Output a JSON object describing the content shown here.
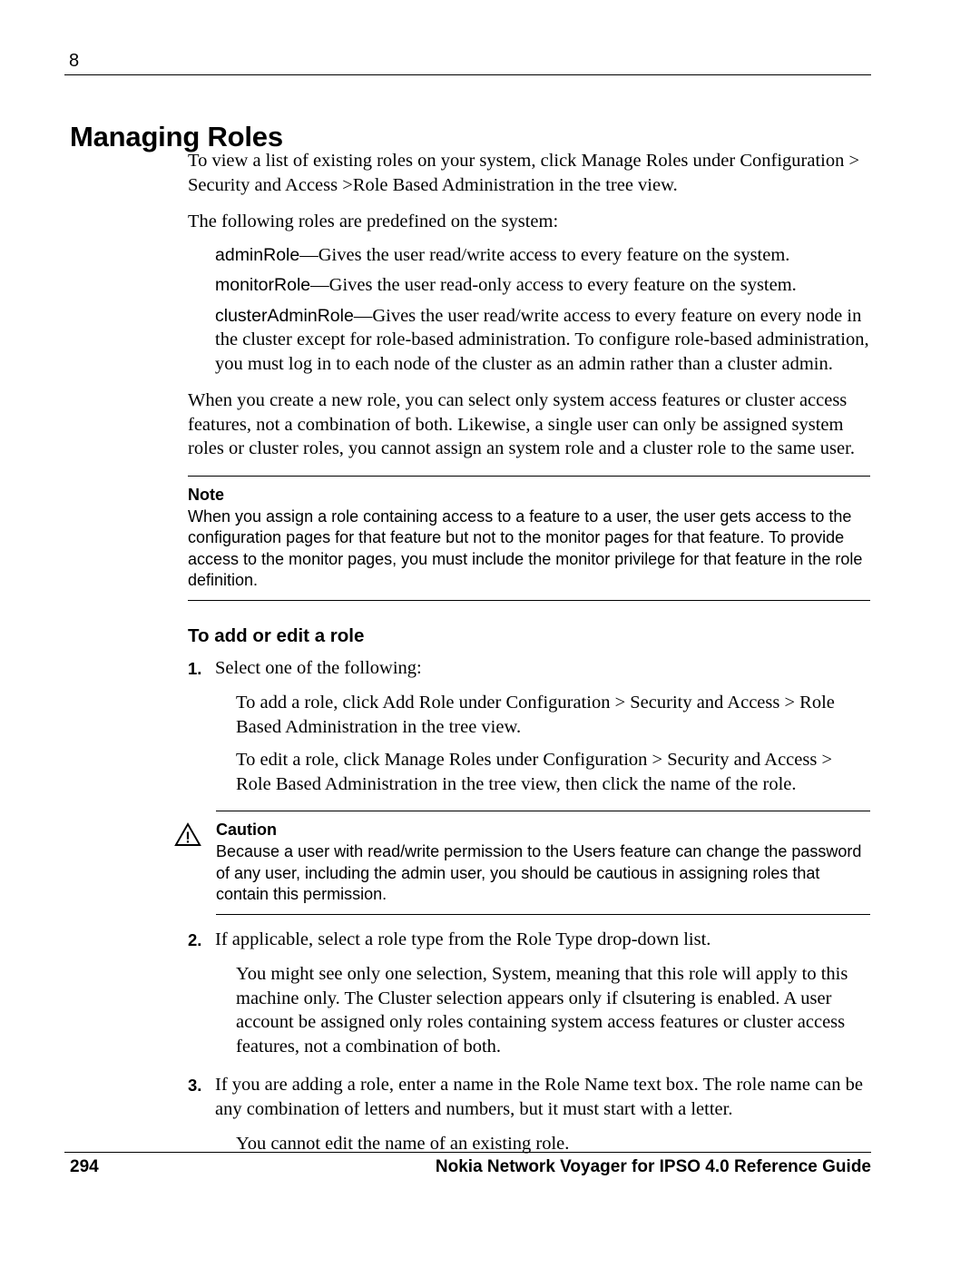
{
  "header": {
    "chapter_number": "8",
    "chapter_title": "Managing Roles"
  },
  "intro": {
    "para1": "To view a list of existing roles on your system, click Manage Roles under Configuration > Security and Access >Role Based Administration in the tree view.",
    "para2": "The following roles are predefined on the system:"
  },
  "roles": [
    {
      "term": "adminRole",
      "dash": "—",
      "description": "Gives the user read/write access to every feature on the system."
    },
    {
      "term": "monitorRole",
      "dash": "—",
      "description": "Gives the user read-only access to every feature on the system."
    },
    {
      "term": "clusterAdminRole",
      "dash": "—",
      "description": "Gives the user read/write access to every feature on every node in the cluster except for role-based administration. To configure role-based administration, you must log in to each node of the cluster as an admin rather than a cluster admin."
    }
  ],
  "body": {
    "para_create_role": "When you create a new role, you can select only system access features or cluster access features, not a combination of both. Likewise, a single user can only be assigned system roles or cluster roles, you cannot assign an system role and a cluster role to the same user."
  },
  "note": {
    "title": "Note",
    "text": "When you assign a role containing access to a feature to a user, the user gets access to the configuration pages for that feature but not to the monitor pages for that feature. To provide access to the monitor pages, you must include the monitor privilege for that feature in the role definition."
  },
  "procedure": {
    "heading": "To add or edit a role",
    "steps": [
      {
        "marker": "1.",
        "text": "Select one of the following:",
        "sub_paragraphs": [
          "To add a role, click Add Role under Configuration > Security and Access > Role Based Administration in the tree view.",
          "To edit a role, click Manage Roles under Configuration > Security and Access > Role Based Administration in the tree view, then click the name of the role."
        ]
      },
      {
        "marker": "2.",
        "text": "If applicable, select a role type from the Role Type drop-down list.",
        "sub_paragraphs": [
          "You might see only one selection, System, meaning that this role will apply to this machine only. The Cluster selection appears only if clsutering is enabled. A user account be assigned only roles containing system access features or cluster access features, not a combination of both."
        ]
      },
      {
        "marker": "3.",
        "text": "If you are adding a role, enter a name in the Role Name text box. The role name can be any combination of letters and numbers, but it must start with a letter.",
        "sub_paragraphs": [
          "You cannot edit the name of an existing role."
        ]
      }
    ]
  },
  "caution": {
    "icon": "warning-triangle-icon",
    "title": "Caution",
    "text": "Because a user with read/write permission to the Users feature can change the password of any user, including the admin user, you should be cautious in assigning roles that contain this permission."
  },
  "footer": {
    "page_number": "294",
    "guide_title": "Nokia Network Voyager for IPSO 4.0 Reference Guide"
  },
  "colors": {
    "text": "#000000",
    "rule": "#000000",
    "background": "#ffffff"
  }
}
